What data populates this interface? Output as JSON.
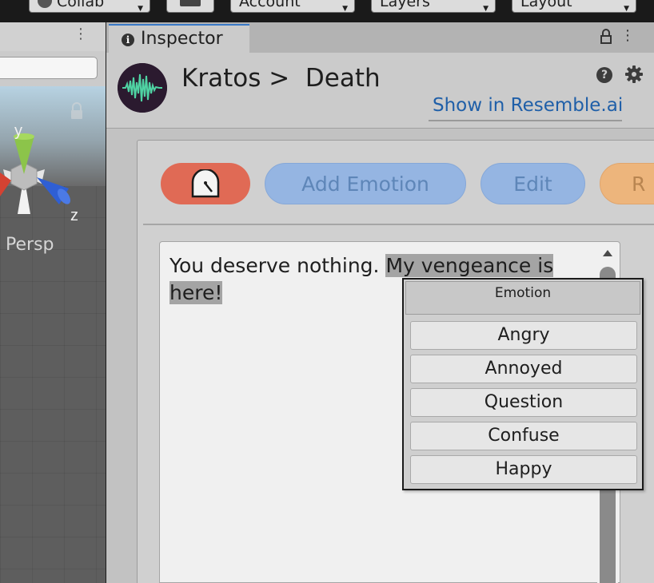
{
  "toolbar": {
    "collab_label": "Collab",
    "account_label": "Account",
    "layers_label": "Layers",
    "layout_label": "Layout"
  },
  "scene": {
    "axis_y": "y",
    "axis_z": "z",
    "projection_label": "Persp"
  },
  "inspector": {
    "tab_label": "Inspector",
    "title": "Kratos >  Death",
    "show_link": "Show in Resemble.ai",
    "buttons": {
      "add_emotion": "Add Emotion",
      "edit": "Edit",
      "partial": "R"
    },
    "text_plain": "You deserve nothing. ",
    "text_selected": "My vengeance is here!"
  },
  "emotion_menu": {
    "header": "Emotion",
    "items": [
      "Angry",
      "Annoyed",
      "Question",
      "Confuse",
      "Happy"
    ]
  },
  "colors": {
    "timer_button": "#e06a55",
    "blue_button": "#95b5e2",
    "orange_button": "#edb57c",
    "link": "#1f5fa8",
    "tab_accent": "#3a79c6"
  }
}
